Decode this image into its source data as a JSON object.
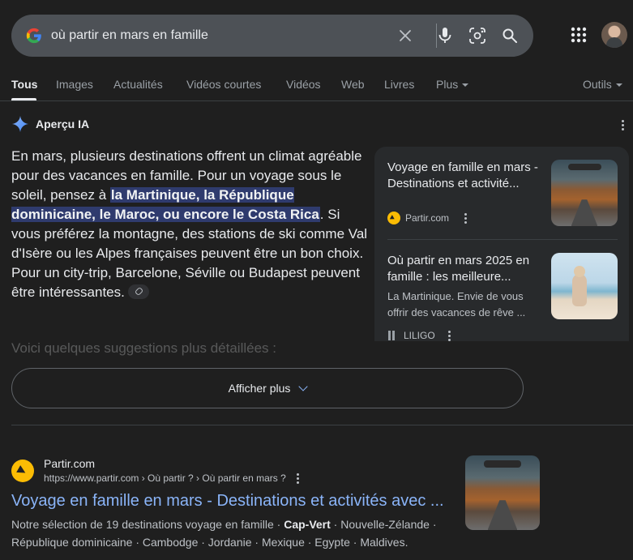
{
  "search": {
    "query": "où partir en mars en famille"
  },
  "tabs": [
    {
      "label": "Tous"
    },
    {
      "label": "Images"
    },
    {
      "label": "Actualités"
    },
    {
      "label": "Vidéos courtes"
    },
    {
      "label": "Vidéos"
    },
    {
      "label": "Web"
    },
    {
      "label": "Livres"
    },
    {
      "label": "Plus"
    }
  ],
  "tools_label": "Outils",
  "ai_overview": {
    "title": "Aperçu IA",
    "text_before": "En mars, plusieurs destinations offrent un climat agréable pour des vacances en famille. Pour un voyage sous le soleil, pensez à ",
    "text_highlight": "la Martinique, la République dominicaine, le Maroc, ou encore le Costa Rica",
    "text_after": ". Si vous préférez la montagne, des stations de ski comme Val d'Isère ou les Alpes françaises peuvent être un bon choix. Pour un city-trip, Barcelone, Séville ou Budapest peuvent être intéressantes.",
    "faded_text": "Voici quelques suggestions plus détaillées :",
    "show_more": "Afficher plus",
    "cards": [
      {
        "title": "Voyage en famille en mars - Destinations et activité...",
        "source": "Partir.com"
      },
      {
        "title": "Où partir en mars 2025 en famille : les meilleure...",
        "snippet": "La Martinique. Envie de vous offrir des vacances de rêve ...",
        "source": "LILIGO"
      }
    ]
  },
  "result": {
    "site": "Partir.com",
    "url": "https://www.partir.com › Où partir ? › Où partir en mars ?",
    "title": "Voyage en famille en mars - Destinations et activités avec ...",
    "snippet_before": "Notre sélection de 19 destinations voyage en famille · ",
    "snippet_bold": "Cap-Vert",
    "snippet_after": " · Nouvelle-Zélande · République dominicaine · Cambodge · Jordanie · Mexique · Egypte · Maldives."
  },
  "colors": {
    "background": "#1f1f1f",
    "search_bar": "#4d5156",
    "link": "#8ab4f8",
    "highlight": "#2f3b6e"
  }
}
